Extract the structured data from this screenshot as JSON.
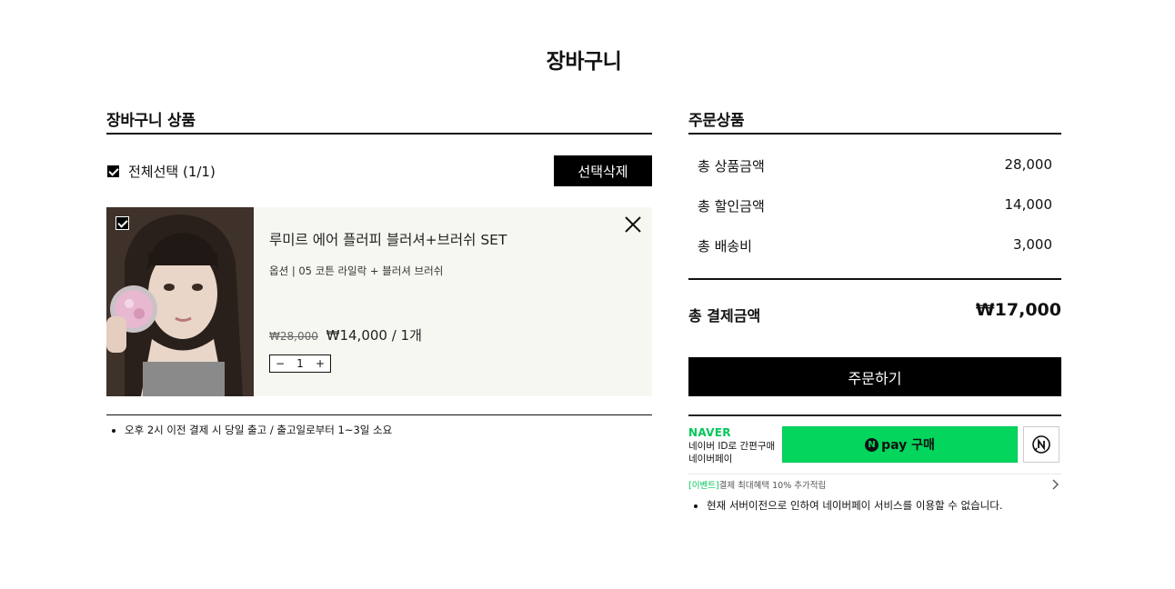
{
  "page": {
    "title": "장바구니"
  },
  "cart": {
    "section_title": "장바구니 상품",
    "select_all_label": "전체선택 (1/1)",
    "delete_selected_label": "선택삭제",
    "item": {
      "name": "루미르 에어 플러피 블러셔+브러쉬 SET",
      "option": "옵션 | 05 코튼 라일락 + 블러셔 브러쉬",
      "original_price": "₩28,000",
      "price": "₩14,000 / 1개",
      "qty_minus": "−",
      "quantity": "1",
      "qty_plus": "+"
    },
    "note": "오후 2시 이전 결제 시 당일 출고 / 출고일로부터 1~3일 소요"
  },
  "order": {
    "section_title": "주문상품",
    "rows": [
      {
        "label": "총 상품금액",
        "value": "28,000"
      },
      {
        "label": "총 할인금액",
        "value": "14,000"
      },
      {
        "label": "총 배송비",
        "value": "3,000"
      }
    ],
    "total_label": "총 결제금액",
    "total_value": "₩17,000",
    "order_button": "주문하기"
  },
  "naver": {
    "logo": "NAVER",
    "desc": "네이버 ID로 간편구매 네이버페이",
    "pay_n": "N",
    "pay_label": "pay 구매",
    "event_tag": "[이벤트]",
    "event_text": "결제 최대혜택 10% 추가적립",
    "notice": "현재 서버이전으로 인하여 네이버페이 서비스를 이용할 수 없습니다."
  },
  "colors": {
    "naver_green": "#03c75a",
    "npay_button": "#03d55d",
    "item_bg": "#f7f7f2"
  }
}
